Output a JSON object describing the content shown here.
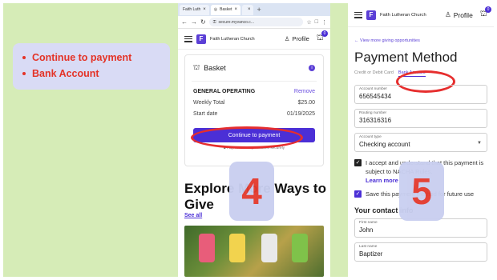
{
  "bullets": [
    "Continue to payment",
    "Bank Account"
  ],
  "browser": {
    "tabs": [
      "Faith Luth",
      "Basket",
      ""
    ],
    "url": "secure.myvanco.c..."
  },
  "header": {
    "logo_letter": "F",
    "church_name": "Faith Lutheran Church",
    "profile_label": "Profile",
    "cart_count": "0"
  },
  "basket": {
    "title": "Basket",
    "fund": "GENERAL OPERATING",
    "remove_label": "Remove",
    "weekly_label": "Weekly Total",
    "weekly_value": "$25.00",
    "start_label": "Start date",
    "start_value": "01/19/2025",
    "continue_label": "Continue to payment",
    "secure_note": "Payments are processed securely"
  },
  "explore": {
    "title": "Explore More Ways to Give",
    "see_all": "See all"
  },
  "steps": [
    "4",
    "5"
  ],
  "payment": {
    "back_link": "View more giving opportunities",
    "title": "Payment Method",
    "tab_card": "Credit or Debit Card",
    "tab_bank": "Bank Account",
    "account_number_label": "Account number",
    "account_number": "656545434",
    "routing_label": "Routing number",
    "routing": "316316316",
    "account_type_label": "Account type",
    "account_type": "Checking account",
    "accept_text": "I accept and understand that this payment is subject to NACHA Rules.",
    "learn_more": "Learn more",
    "save_text": "Save this payment method for future use",
    "contact_heading": "Your contact info",
    "first_name_label": "First name",
    "first_name": "John",
    "last_name_label": "Last name",
    "last_name": "Baptizer"
  },
  "colors": {
    "background": "#d6ecb7",
    "accent": "#4b2fd6",
    "highlight": "#e62e2e"
  }
}
